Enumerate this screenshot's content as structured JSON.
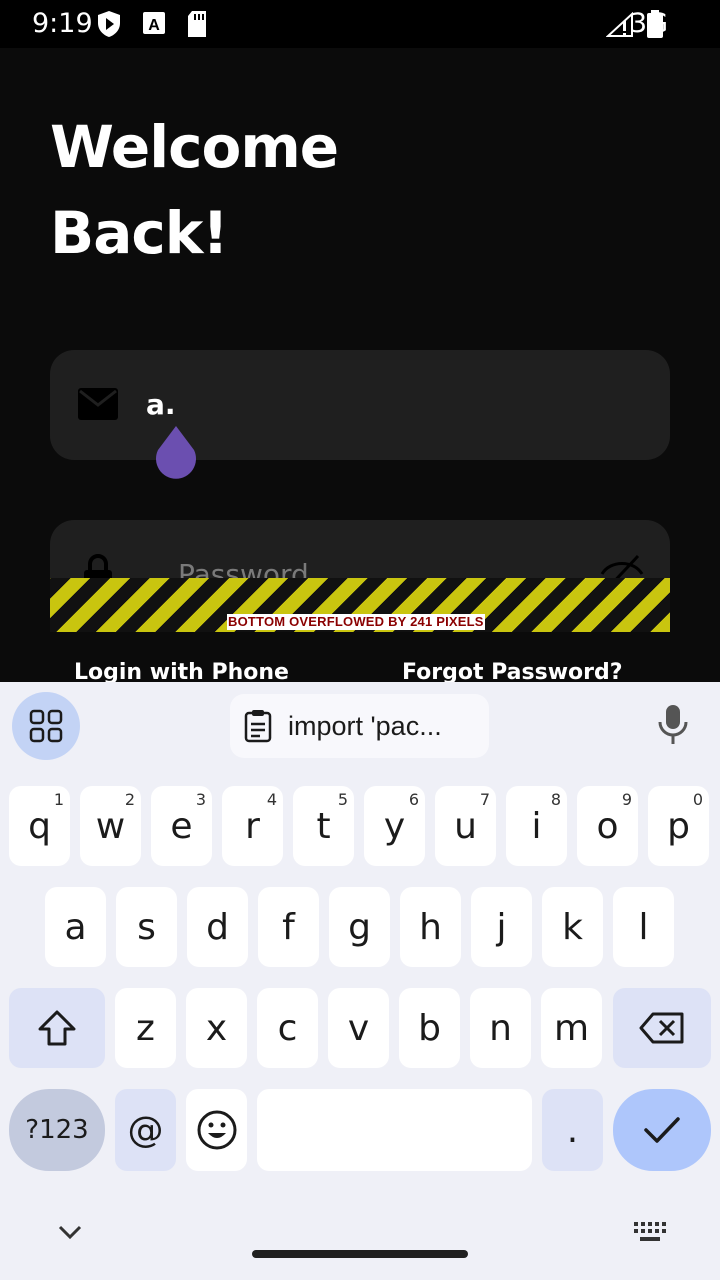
{
  "status": {
    "time": "9:19",
    "network": "3G"
  },
  "screen": {
    "title_line1": "Welcome",
    "title_line2": "Back!",
    "email": {
      "value": "a."
    },
    "password": {
      "placeholder": "Password"
    },
    "overflow_message": "BOTTOM OVERFLOWED BY 241 PIXELS",
    "login_with_phone": "Login with Phone",
    "forgot_password": "Forgot Password?"
  },
  "keyboard": {
    "clipboard_suggestion": "import 'pac...",
    "row1": [
      {
        "label": "q",
        "hint": "1"
      },
      {
        "label": "w",
        "hint": "2"
      },
      {
        "label": "e",
        "hint": "3"
      },
      {
        "label": "r",
        "hint": "4"
      },
      {
        "label": "t",
        "hint": "5"
      },
      {
        "label": "y",
        "hint": "6"
      },
      {
        "label": "u",
        "hint": "7"
      },
      {
        "label": "i",
        "hint": "8"
      },
      {
        "label": "o",
        "hint": "9"
      },
      {
        "label": "p",
        "hint": "0"
      }
    ],
    "row2": [
      "a",
      "s",
      "d",
      "f",
      "g",
      "h",
      "j",
      "k",
      "l"
    ],
    "row3": [
      "z",
      "x",
      "c",
      "v",
      "b",
      "n",
      "m"
    ],
    "symbols_label": "?123",
    "at_label": "@",
    "period_label": "."
  },
  "colors": {
    "accent_drop": "#6b4fb0",
    "hazard_yellow": "#c9c50f",
    "keyboard_bg": "#eff0f7"
  }
}
